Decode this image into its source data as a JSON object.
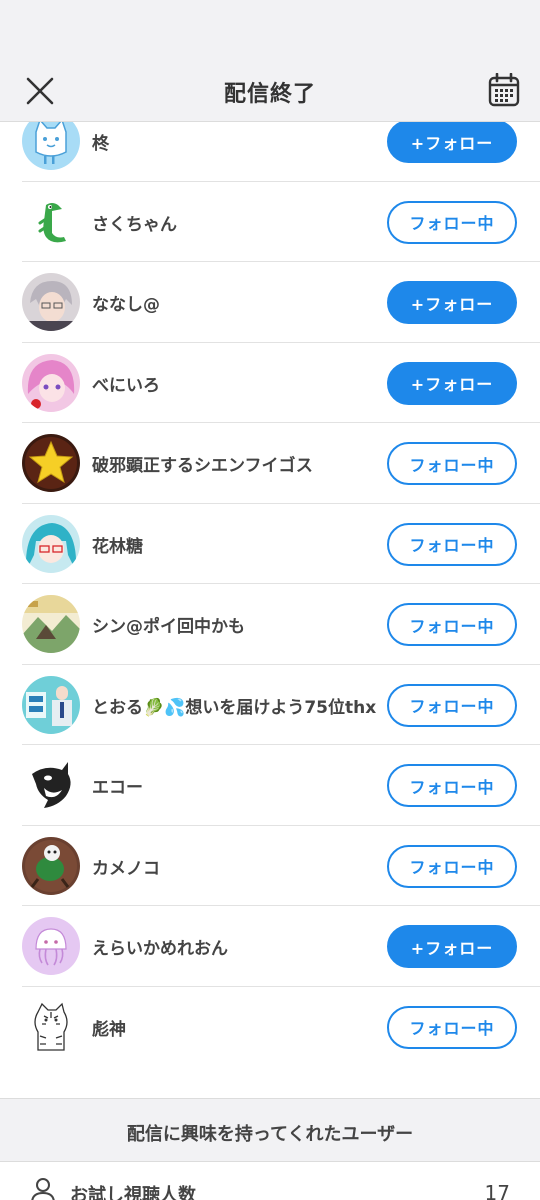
{
  "header": {
    "title": "配信終了",
    "close_icon": "close-icon",
    "calendar_icon": "calendar-icon"
  },
  "colors": {
    "accent": "#1e88ea",
    "header_bg": "#f2f2f4",
    "text": "#444444"
  },
  "users": [
    {
      "name": "柊",
      "button": "+フォロー",
      "state": "follow",
      "avatar": "white-cat-avatar"
    },
    {
      "name": "さくちゃん",
      "button": "フォロー中",
      "state": "following",
      "avatar": "green-crocodile-avatar"
    },
    {
      "name": "ななし@",
      "button": "+フォロー",
      "state": "follow",
      "avatar": "gray-hair-anime-avatar"
    },
    {
      "name": "べにいろ",
      "button": "+フォロー",
      "state": "follow",
      "avatar": "pink-hair-anime-avatar"
    },
    {
      "name": "破邪顕正するシエンフイゴス",
      "button": "フォロー中",
      "state": "following",
      "avatar": "yellow-star-avatar"
    },
    {
      "name": "花林糖",
      "button": "フォロー中",
      "state": "following",
      "avatar": "teal-hair-anime-avatar"
    },
    {
      "name": "シン@ポイ回中かも",
      "button": "フォロー中",
      "state": "following",
      "avatar": "landscape-illustration-avatar"
    },
    {
      "name": "とおる🥬💦想いを届けよう75位thx",
      "button": "フォロー中",
      "state": "following",
      "avatar": "chokei-logo-avatar"
    },
    {
      "name": "エコー",
      "button": "フォロー中",
      "state": "following",
      "avatar": "orca-avatar"
    },
    {
      "name": "カメノコ",
      "button": "フォロー中",
      "state": "following",
      "avatar": "turtle-character-avatar"
    },
    {
      "name": "えらいかめれおん",
      "button": "+フォロー",
      "state": "follow",
      "avatar": "pink-jellyfish-avatar"
    },
    {
      "name": "彪神",
      "button": "フォロー中",
      "state": "following",
      "avatar": "tiger-sketch-avatar"
    }
  ],
  "section": {
    "title": "配信に興味を持ってくれたユーザー"
  },
  "stats": {
    "trial_viewers_label": "お試し視聴人数",
    "trial_viewers_value": "17",
    "icon": "person-icon"
  }
}
